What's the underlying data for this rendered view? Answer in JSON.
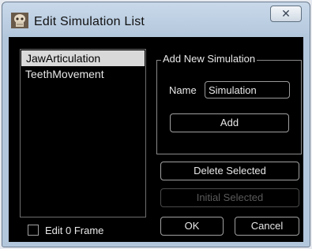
{
  "window": {
    "title": "Edit Simulation List",
    "close_glyph": "✕"
  },
  "icons": {
    "app": "skull-icon",
    "close": "close-icon"
  },
  "simulations": {
    "items": [
      {
        "label": "JawArticulation",
        "selected": true
      },
      {
        "label": "TeethMovement",
        "selected": false
      }
    ]
  },
  "add_group": {
    "title": "Add New Simulation",
    "name_label": "Name",
    "name_value": "Simulation",
    "add_label": "Add"
  },
  "actions": {
    "delete_label": "Delete Selected",
    "initial_label": "Initial Selected",
    "ok_label": "OK",
    "cancel_label": "Cancel"
  },
  "edit_frame": {
    "label": "Edit 0 Frame",
    "checked": false
  },
  "colors": {
    "client_bg": "#000000",
    "selection": "#d9d9d9",
    "titlebar": "#c9d9ea"
  }
}
